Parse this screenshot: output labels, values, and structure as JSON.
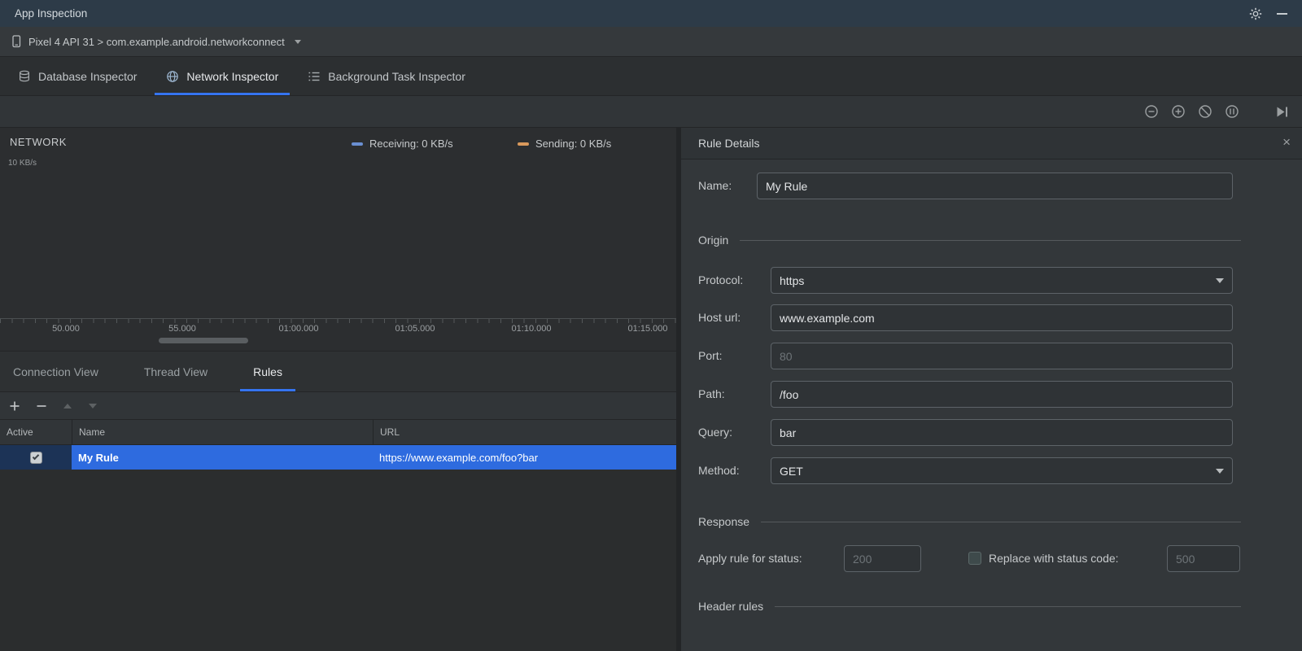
{
  "colors": {
    "accent": "#3574f0",
    "selection_blue": "#2e6bdf",
    "receiving_series": "#6a8fd2",
    "sending_series": "#d9995c",
    "titlebar_bg": "#2d3b48"
  },
  "glyphs": {
    "close": "×"
  },
  "titlebar": {
    "title": "App Inspection"
  },
  "device_bar": {
    "selector": "Pixel 4 API 31 > com.example.android.networkconnect"
  },
  "inspector_tabs": [
    {
      "label": "Database Inspector"
    },
    {
      "label": "Network Inspector"
    },
    {
      "label": "Background Task Inspector"
    }
  ],
  "network_chart": {
    "title": "NETWORK",
    "legend": {
      "receiving": "Receiving: 0 KB/s",
      "sending": "Sending: 0 KB/s"
    },
    "y_axis_label": "10 KB/s",
    "x_ticks": [
      "50.000",
      "55.000",
      "01:00.000",
      "01:05.000",
      "01:10.000",
      "01:15.000"
    ]
  },
  "view_tabs": [
    {
      "label": "Connection View"
    },
    {
      "label": "Thread View"
    },
    {
      "label": "Rules"
    }
  ],
  "rules_table": {
    "columns": {
      "active": "Active",
      "name": "Name",
      "url": "URL"
    },
    "rows": [
      {
        "active": true,
        "name": "My Rule",
        "url": "https://www.example.com/foo?bar"
      }
    ]
  },
  "rule_details": {
    "title": "Rule Details",
    "name": {
      "label": "Name:",
      "value": "My Rule"
    },
    "sections": {
      "origin": "Origin",
      "response": "Response",
      "header_rules": "Header rules"
    },
    "origin": {
      "protocol": {
        "label": "Protocol:",
        "value": "https"
      },
      "host": {
        "label": "Host url:",
        "value": "www.example.com"
      },
      "port": {
        "label": "Port:",
        "placeholder": "80"
      },
      "path": {
        "label": "Path:",
        "value": "/foo"
      },
      "query": {
        "label": "Query:",
        "value": "bar"
      },
      "method": {
        "label": "Method:",
        "value": "GET"
      }
    },
    "response": {
      "apply_status": {
        "label": "Apply rule for status:",
        "placeholder": "200"
      },
      "replace_status": {
        "label": "Replace with status code:",
        "placeholder": "500",
        "checked": false
      }
    }
  }
}
